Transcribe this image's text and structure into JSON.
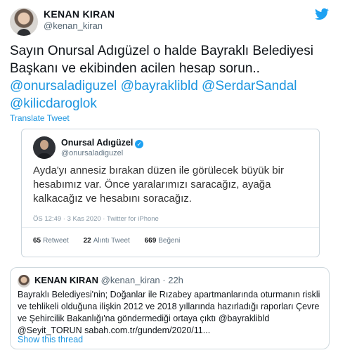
{
  "tweet": {
    "author_name": "KENAN KIRAN",
    "author_handle": "@kenan_kiran",
    "logo_icon": "twitter-bird-icon",
    "brand_color": "#1da1f2",
    "link_color": "#1b95e0",
    "text_lines": [
      "Sayın Onursal Adıgüzel o halde Bayraklı Belediyesi",
      "Başkanı ve ekibinden acilen hesap sorun.."
    ],
    "mentions_line1": "@onursaladiguzel @bayraklibld @SerdarSandal",
    "mentions_line2": "@kilicdaroglok",
    "translate_label": "Translate Tweet"
  },
  "embedded_tweet": {
    "author_name": "Onursal Adıgüzel",
    "verified_icon": "verified-badge-icon",
    "author_handle": "@onursaladiguzel",
    "text_lines": [
      "Ayda'yı annesiz bırakan düzen ile görülecek büyük bir",
      "hesabımız var. Önce yaralarımızı saracağız, ayağa",
      "kalkacağız ve hesabını soracağız."
    ],
    "meta": "ÖS 12:49 · 3 Kas 2020 · Twitter for iPhone",
    "stats": [
      {
        "count": "65",
        "label": "Retweet"
      },
      {
        "count": "22",
        "label": "Alıntı Tweet"
      },
      {
        "count": "669",
        "label": "Beğeni"
      }
    ]
  },
  "quoted_tweet": {
    "author_name": "KENAN KIRAN",
    "author_handle": "@kenan_kiran",
    "time": "· 22h",
    "text_lines": [
      "Bayraklı Belediyesi'nin; Doğanlar ile Rızabey apartmanlarında oturmanın riskli",
      "ve tehlikeli olduğuna ilişkin 2012 ve 2018 yıllarında hazırladığı raporları Çevre",
      "ve Şehircilik Bakanlığı'na göndermediği ortaya çıktı @bayraklibld",
      "@Seyit_TORUN sabah.com.tr/gundem/2020/11..."
    ],
    "show_thread_label": "Show this thread"
  }
}
